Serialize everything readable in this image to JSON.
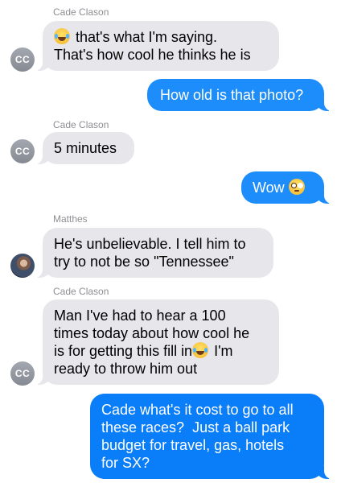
{
  "messages": [
    {
      "sender": "Cade Clason",
      "avatar": "CC",
      "text": "that's what I'm saying.\nThat's how cool he thinks he is",
      "emoji": "joy-emoji"
    },
    {
      "text": "How old is that photo?"
    },
    {
      "sender": "Cade Clason",
      "avatar": "CC",
      "text": "5 minutes"
    },
    {
      "text": "Wow",
      "emoji": "flushed-emoji"
    },
    {
      "sender": "Matthes",
      "text": "He's unbelievable. I tell him to\ntry to not be so \"Tennessee\""
    },
    {
      "sender": "Cade Clason",
      "avatar": "CC",
      "text_a": "Man I've had to hear a 100\ntimes today about how cool he\nis for getting this fill in",
      "text_b": " I'm\nready to throw him out",
      "emoji": "joy-emoji"
    },
    {
      "text": "Cade what's it cost to go to all\nthese races?  Just a ball park\nbudget for travel, gas, hotels\nfor SX?"
    }
  ],
  "colors": {
    "incoming_bubble": "#e6e6eb",
    "outgoing_bubble": "#1d8dfb",
    "sender_label": "#8e8e93"
  }
}
